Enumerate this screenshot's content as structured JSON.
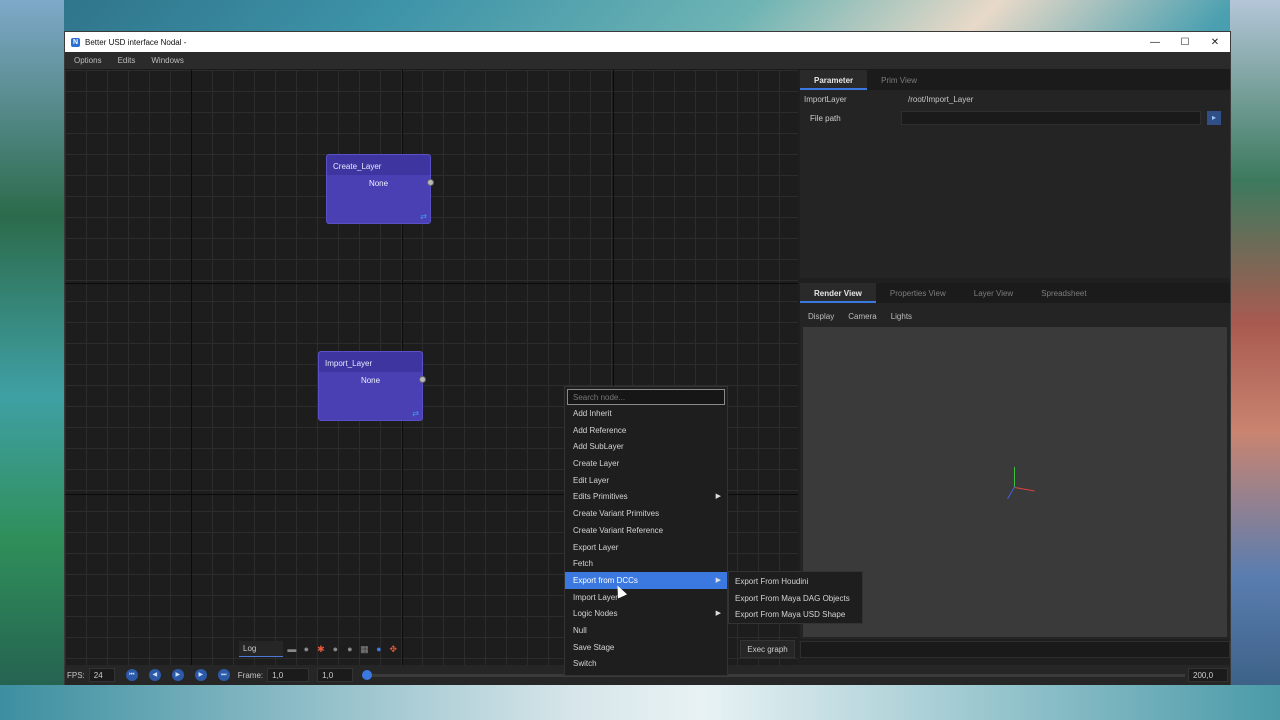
{
  "window": {
    "title": "Better USD interface Nodal -",
    "minimize_glyph": "—",
    "maximize_glyph": "☐",
    "close_glyph": "✕"
  },
  "menubar": {
    "items": [
      "Options",
      "Edits",
      "Windows"
    ]
  },
  "nodes": [
    {
      "title": "Create_Layer",
      "value": "None"
    },
    {
      "title": "Import_Layer",
      "value": "None"
    }
  ],
  "graph_toolbar": {
    "log_tab": "Log"
  },
  "exec_graph": "Exec graph",
  "parameter_panel": {
    "tabs": [
      "Parameter",
      "Prim View"
    ],
    "node_label": "ImportLayer",
    "node_path": "/root/Import_Layer",
    "file_path_label": "File path",
    "file_path_value": ""
  },
  "render_panel": {
    "tabs": [
      "Render View",
      "Properties View",
      "Layer View",
      "Spreadsheet"
    ],
    "subtabs": [
      "Display",
      "Camera",
      "Lights"
    ]
  },
  "playback": {
    "fps_label": "FPS:",
    "fps_value": "24",
    "frame_label": "Frame:",
    "frame_value": "1,0",
    "start_value": "1,0",
    "end_value": "200,0"
  },
  "context_menu": {
    "search_placeholder": "Search node...",
    "items": [
      "Add Inherit",
      "Add Reference",
      "Add SubLayer",
      "Create Layer",
      "Edit Layer",
      "Edits Primitives",
      "Create Variant Primitves",
      "Create Variant Reference",
      "Export Layer",
      "Fetch",
      "Export from DCCs",
      "Import Layer",
      "Logic Nodes",
      "Null",
      "Save Stage",
      "Switch"
    ],
    "submenu_items": [
      "Export From Houdini",
      "Export From Maya DAG Objects",
      "Export From Maya USD Shape"
    ]
  },
  "colors": {
    "accent": "#3b79e0",
    "node_fill": "#4a3fb3",
    "panel_bg": "#242424"
  }
}
